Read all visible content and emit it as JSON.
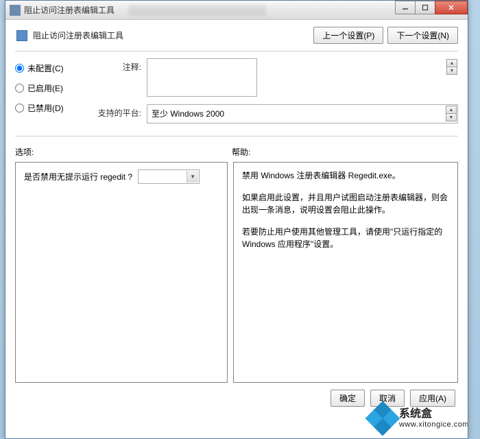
{
  "window": {
    "title": "阻止访问注册表编辑工具"
  },
  "header": {
    "title": "阻止访问注册表编辑工具"
  },
  "nav": {
    "prev": "上一个设置(P)",
    "next": "下一个设置(N)"
  },
  "radios": {
    "not_configured": "未配置(C)",
    "enabled": "已启用(E)",
    "disabled": "已禁用(D)",
    "selected": "not_configured"
  },
  "fields": {
    "comment_label": "注释:",
    "comment_value": "",
    "platform_label": "支持的平台:",
    "platform_value": "至少 Windows 2000"
  },
  "sections": {
    "options_label": "选项:",
    "help_label": "帮助:"
  },
  "options": {
    "question": "是否禁用无提示运行 regedit ?",
    "combo_value": ""
  },
  "help": {
    "p1": "禁用 Windows 注册表编辑器 Regedit.exe。",
    "p2": "如果启用此设置，并且用户试图启动注册表编辑器，则会出现一条消息，说明设置会阻止此操作。",
    "p3": "若要防止用户使用其他管理工具，请使用\"只运行指定的 Windows 应用程序\"设置。"
  },
  "buttons": {
    "ok": "确定",
    "cancel": "取消",
    "apply": "应用(A)"
  },
  "watermark": {
    "brand": "系统盒",
    "url": "www.xitongice.com"
  }
}
